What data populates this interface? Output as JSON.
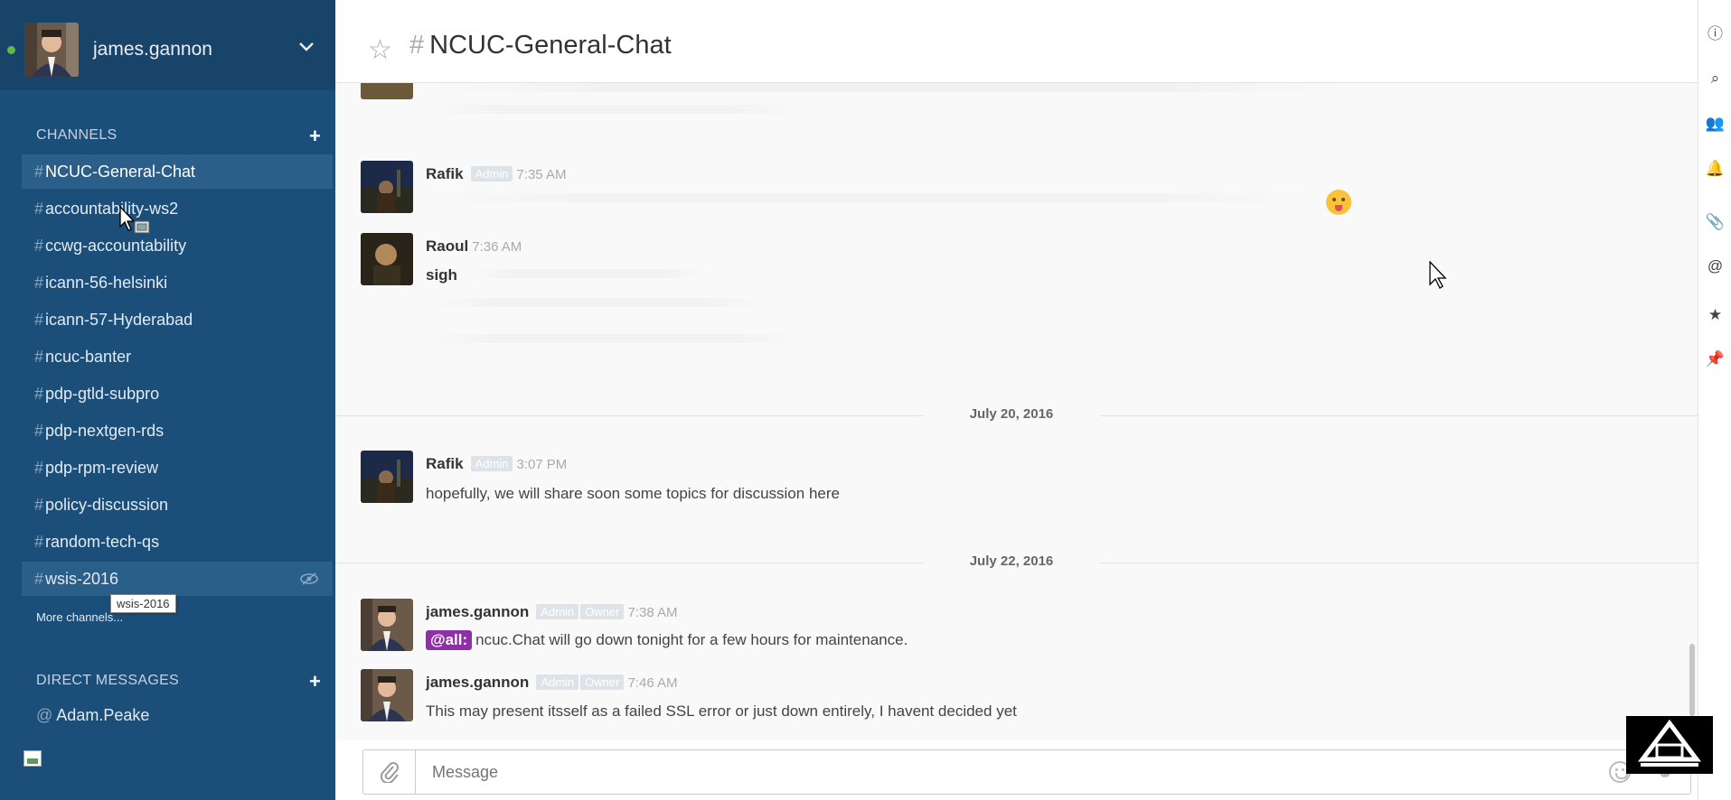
{
  "sidebar": {
    "user": {
      "name": "james.gannon",
      "status_color": "#5fba4a"
    },
    "channels_title": "CHANNELS",
    "channels": [
      {
        "label": "NCUC-General-Chat",
        "active": true
      },
      {
        "label": "accountability-ws2"
      },
      {
        "label": "ccwg-accountability"
      },
      {
        "label": "icann-56-helsinki"
      },
      {
        "label": "icann-57-Hyderabad"
      },
      {
        "label": "ncuc-banter"
      },
      {
        "label": "pdp-gtld-subpro"
      },
      {
        "label": "pdp-nextgen-rds"
      },
      {
        "label": "pdp-rpm-review"
      },
      {
        "label": "policy-discussion"
      },
      {
        "label": "random-tech-qs"
      },
      {
        "label": "wsis-2016",
        "hover": true
      }
    ],
    "tooltip": "wsis-2016",
    "more_channels": "More channels...",
    "dm_title": "DIRECT MESSAGES",
    "direct_messages": [
      {
        "label": "Adam.Peake"
      }
    ],
    "colors": {
      "background": "#1b4f7a",
      "active": "#2b5e88"
    }
  },
  "header": {
    "channel": "NCUC-General-Chat"
  },
  "feed": {
    "messages": [
      {
        "author": "Rafik",
        "badges": [
          "Admin"
        ],
        "time": "7:35 AM",
        "text": ""
      },
      {
        "author": "Raoul",
        "badges": [],
        "time": "7:36 AM",
        "text": "sigh"
      },
      {
        "author": "Rafik",
        "badges": [
          "Admin"
        ],
        "time": "3:07 PM",
        "text": "hopefully, we will share soon some topics for discussion here"
      },
      {
        "author": "james.gannon",
        "badges": [
          "Admin",
          "Owner"
        ],
        "time": "7:38 AM",
        "mention": "@all:",
        "text": "ncuc.Chat will go down tonight for a few hours for maintenance."
      },
      {
        "author": "james.gannon",
        "badges": [
          "Admin",
          "Owner"
        ],
        "time": "7:46 AM",
        "text": "This may present itsself as a failed SSL error or just down entirely, I havent decided yet"
      }
    ],
    "dates": [
      "July 20, 2016",
      "July 22, 2016"
    ]
  },
  "composer": {
    "placeholder": "Message",
    "accent": "#8f30a8"
  },
  "rail": {
    "icons": [
      "info-icon",
      "search-icon",
      "members-icon",
      "notification-icon",
      "files-icon",
      "mentions-icon",
      "starred-icon",
      "pinned-icon"
    ]
  }
}
